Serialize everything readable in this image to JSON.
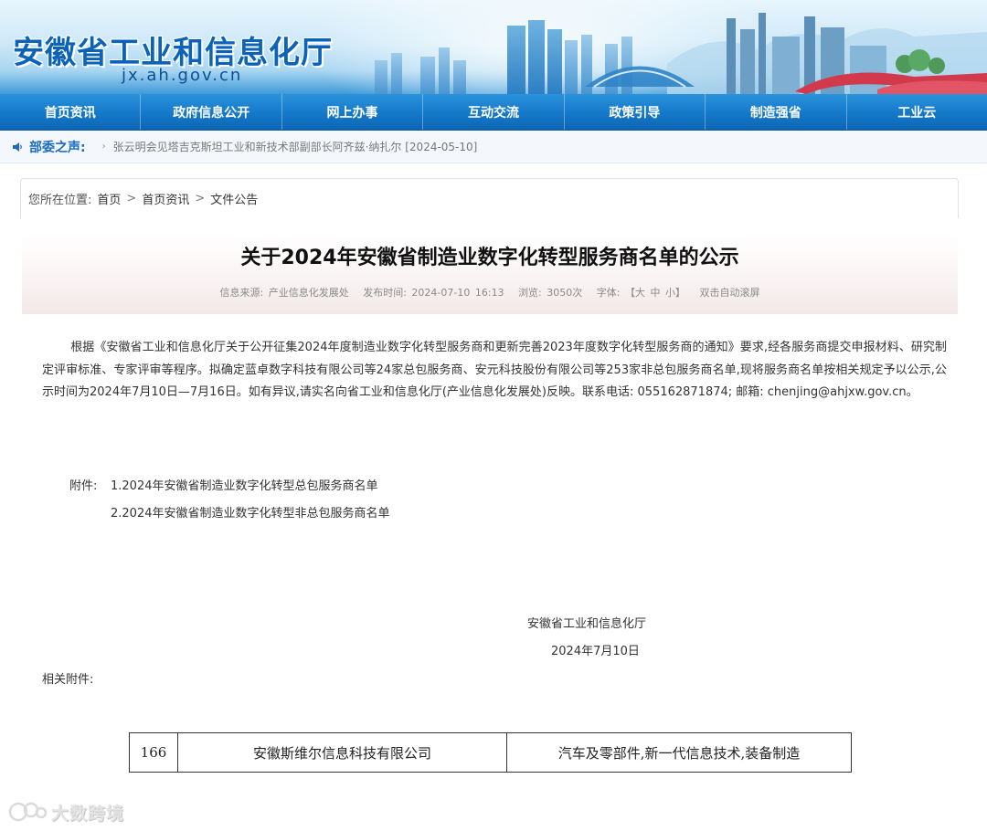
{
  "header": {
    "site_title": "安徽省工业和信息化厅",
    "domain": "jx.ah.gov.cn"
  },
  "nav": {
    "items": [
      "首页资讯",
      "政府信息公开",
      "网上办事",
      "互动交流",
      "政策引导",
      "制造强省",
      "工业云"
    ]
  },
  "ticker": {
    "label": "部委之声:",
    "arrow": "›",
    "news": "张云明会见塔吉克斯坦工业和新技术部副部长阿齐兹·纳扎尔 [2024-05-10]"
  },
  "breadcrumb": {
    "prefix": "您所在位置:",
    "items": [
      "首页",
      "首页资讯",
      "文件公告"
    ],
    "separator": ">"
  },
  "article": {
    "title": "关于2024年安徽省制造业数字化转型服务商名单的公示",
    "meta": {
      "source": "信息来源: 产业信息化发展处",
      "publish_time": "发布时间: 2024-07-10 16:13",
      "views": "浏览: 3050次",
      "font_size": "字体: 【大 中 小】",
      "auto_scroll": "双击自动滚屏"
    },
    "body": "根据《安徽省工业和信息化厅关于公开征集2024年度制造业数字化转型服务商和更新完善2023年度数字化转型服务商的通知》要求,经各服务商提交申报材料、研究制定评审标准、专家评审等程序。拟确定蓝卓数字科技有限公司等24家总包服务商、安元科技股份有限公司等253家非总包服务商名单,现将服务商名单按相关规定予以公示,公示时间为2024年7月10日—7月16日。如有异议,请实名向省工业和信息化厅(产业信息化发展处)反映。联系电话: 055162871874; 邮箱: chenjing@ahjxw.gov.cn。",
    "attachments_label": "附件:",
    "attachments": [
      "1.2024年安徽省制造业数字化转型总包服务商名单",
      "2.2024年安徽省制造业数字化转型非总包服务商名单"
    ],
    "signature_org": "安徽省工业和信息化厅",
    "signature_date": "2024年7月10日",
    "related_attachments": "相关附件:"
  },
  "table_row": {
    "no": "166",
    "company": "安徽斯维尔信息科技有限公司",
    "fields": "汽车及零部件,新一代信息技术,装备制造"
  },
  "watermark": {
    "text": "大数跨境"
  },
  "colors": {
    "title_blue": "#0a63b8",
    "nav_blue": "#1478c9",
    "ticker_label": "#1a6cc0"
  }
}
